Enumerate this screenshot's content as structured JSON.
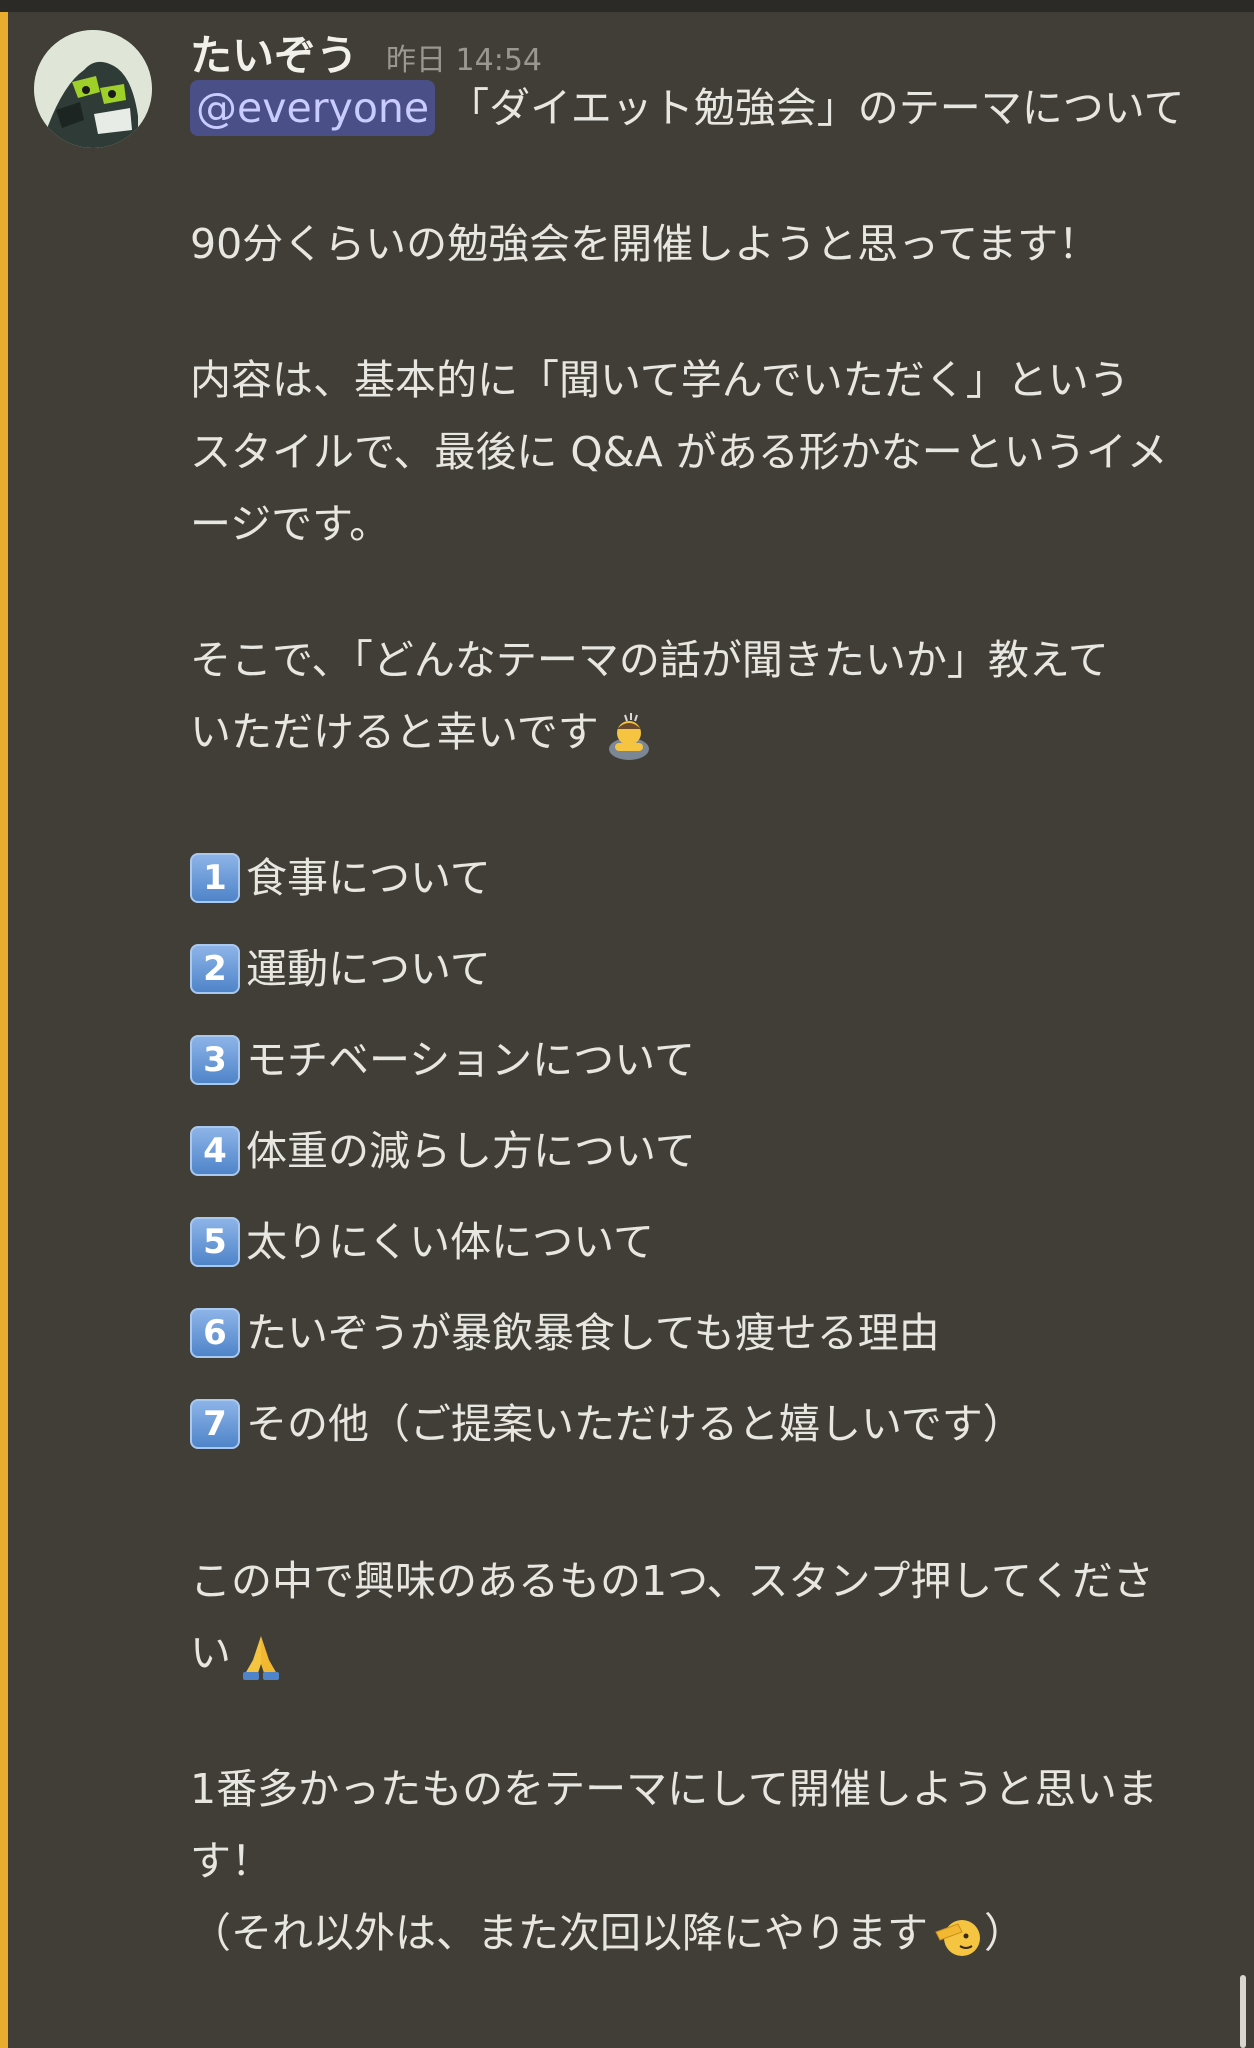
{
  "message": {
    "author": "たいぞう",
    "timestamp": "昨日 14:54",
    "mention": "@everyone",
    "title_rest": " 「ダイエット勉強会」のテーマについて",
    "intro": "90分くらいの勉強会を開催しようと思ってます！",
    "content_lines": [
      "内容は、基本的に「聞いて学んでいただく」という",
      "スタイルで、最後に Q&A がある形かなーというイメ",
      "ージです。"
    ],
    "ask_lines": [
      "そこで、「どんなテーマの話が聞きたいか」教えて",
      "いただけると幸いです"
    ],
    "options": [
      {
        "number": "1",
        "label": "食事について"
      },
      {
        "number": "2",
        "label": "運動について"
      },
      {
        "number": "3",
        "label": "モチベーションについて"
      },
      {
        "number": "4",
        "label": "体重の減らし方について"
      },
      {
        "number": "5",
        "label": "太りにくい体について"
      },
      {
        "number": "6",
        "label": "たいぞうが暴飲暴食しても痩せる理由"
      },
      {
        "number": "7",
        "label": "その他（ご提案いただけると嬉しいです）"
      }
    ],
    "stamp_lines": [
      "この中で興味のあるもの1つ、スタンプ押してくださ",
      "い"
    ],
    "closing_lines": [
      "1番多かったものをテーマにして開催しようと思いま",
      "す！"
    ],
    "aside_text": "（それ以外は、また次回以降にやります",
    "aside_close": "）"
  },
  "icons": {
    "bow": "person-bowing-emoji",
    "pray": "folded-hands-emoji",
    "salute": "saluting-face-emoji"
  },
  "colors": {
    "background": "#403e36",
    "mention_bg": "#4a4f88",
    "mention_text": "#c9ccff",
    "highlight_stripe": "#e8ad2f"
  }
}
